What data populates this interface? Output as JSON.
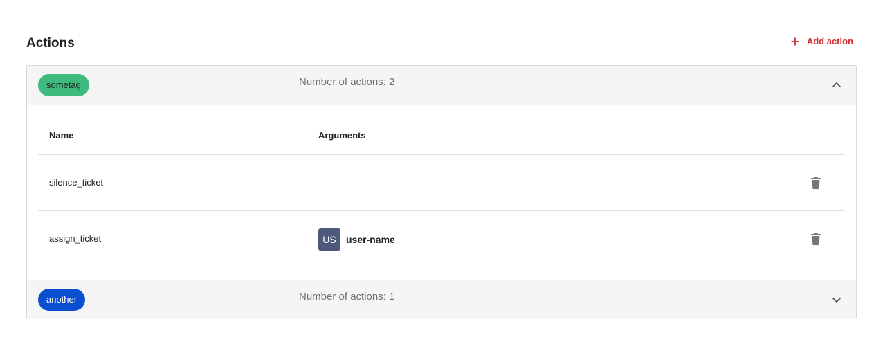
{
  "header": {
    "title": "Actions",
    "add_label": "Add action"
  },
  "groups": [
    {
      "tag": "sometag",
      "tag_color": "#3dba7d",
      "tag_text_color": "#1f1f1f",
      "count_text": "Number of actions: 2",
      "expanded": true,
      "columns": {
        "name": "Name",
        "arguments": "Arguments"
      },
      "rows": [
        {
          "name": "silence_ticket",
          "arguments": "-"
        },
        {
          "name": "assign_ticket",
          "avatar_initials": "US",
          "username": "user-name"
        }
      ]
    },
    {
      "tag": "another",
      "tag_color": "#0a4fcf",
      "tag_text_color": "#ffffff",
      "count_text": "Number of actions: 1",
      "expanded": false
    }
  ],
  "icons": {
    "add": "plus-icon",
    "collapse": "chevron-up-icon",
    "expand": "chevron-down-icon",
    "delete": "trash-icon"
  },
  "colors": {
    "accent": "#d32f2f",
    "avatar_bg": "#4d5a7c"
  }
}
